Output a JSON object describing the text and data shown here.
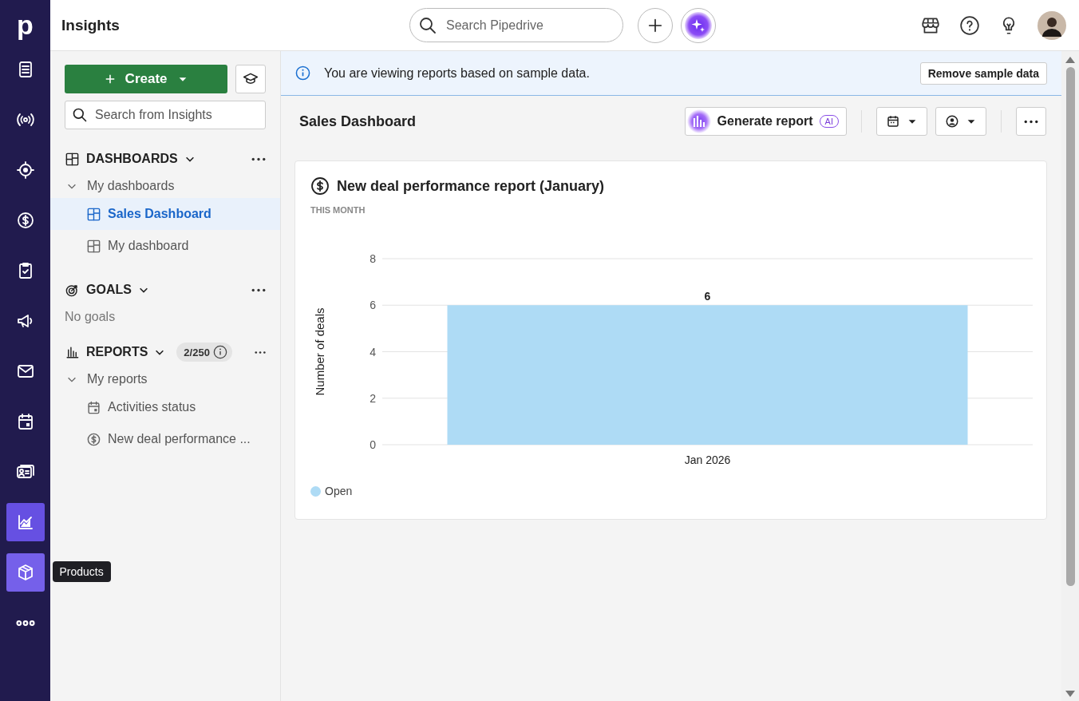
{
  "top_bar": {
    "logo": "p",
    "section_title": "Insights",
    "search": {
      "placeholder": "Search Pipedrive"
    }
  },
  "nav_rail": {
    "items": [
      {
        "selected": false,
        "hovered": false
      },
      {
        "selected": false,
        "hovered": false
      },
      {
        "selected": false,
        "hovered": false
      },
      {
        "selected": false,
        "hovered": false
      },
      {
        "selected": false,
        "hovered": false
      },
      {
        "selected": false,
        "hovered": false
      },
      {
        "selected": false,
        "hovered": false
      },
      {
        "selected": false,
        "hovered": false
      },
      {
        "selected": false,
        "hovered": false
      },
      {
        "selected": true,
        "hovered": false
      },
      {
        "selected": false,
        "hovered": true
      },
      {
        "selected": false,
        "hovered": false
      }
    ],
    "tooltip": "Products"
  },
  "sidebar": {
    "create_button": "Create",
    "search": {
      "placeholder": "Search from Insights"
    },
    "sections": [
      {
        "kind": "dashboards",
        "title": "DASHBOARDS",
        "groups": [
          {
            "title": "My dashboards",
            "expanded": true,
            "children": [
              {
                "label": "Sales Dashboard",
                "kind": "dashboard",
                "selected": true
              },
              {
                "label": "My dashboard",
                "kind": "dashboard",
                "selected": false
              }
            ]
          }
        ]
      },
      {
        "kind": "goals",
        "title": "GOALS",
        "empty_text": "No goals"
      },
      {
        "kind": "reports",
        "title": "REPORTS",
        "count": "2/250",
        "groups": [
          {
            "title": "My reports",
            "expanded": true,
            "children": [
              {
                "label": "Activities status",
                "kind": "activity",
                "selected": false
              },
              {
                "label": "New deal performance ...",
                "kind": "deal",
                "selected": false
              }
            ]
          }
        ]
      }
    ]
  },
  "banner": {
    "message": "You are viewing reports based on sample data.",
    "button": "Remove sample data"
  },
  "dashboard": {
    "title": "Sales Dashboard",
    "generate_button": "Generate report",
    "ai_badge": "AI"
  },
  "report_card": {
    "title": "New deal performance report (January)",
    "period": "THIS MONTH",
    "chart_data": {
      "type": "bar",
      "ylabel": "Number of deals",
      "categories": [
        "Jan 2026"
      ],
      "series": [
        {
          "name": "Open",
          "color": "#aedbf5",
          "values": [
            6
          ]
        }
      ],
      "ylim": [
        0,
        8
      ],
      "yticks": [
        0,
        2,
        4,
        6,
        8
      ],
      "grid": true,
      "data_labels": true
    }
  }
}
